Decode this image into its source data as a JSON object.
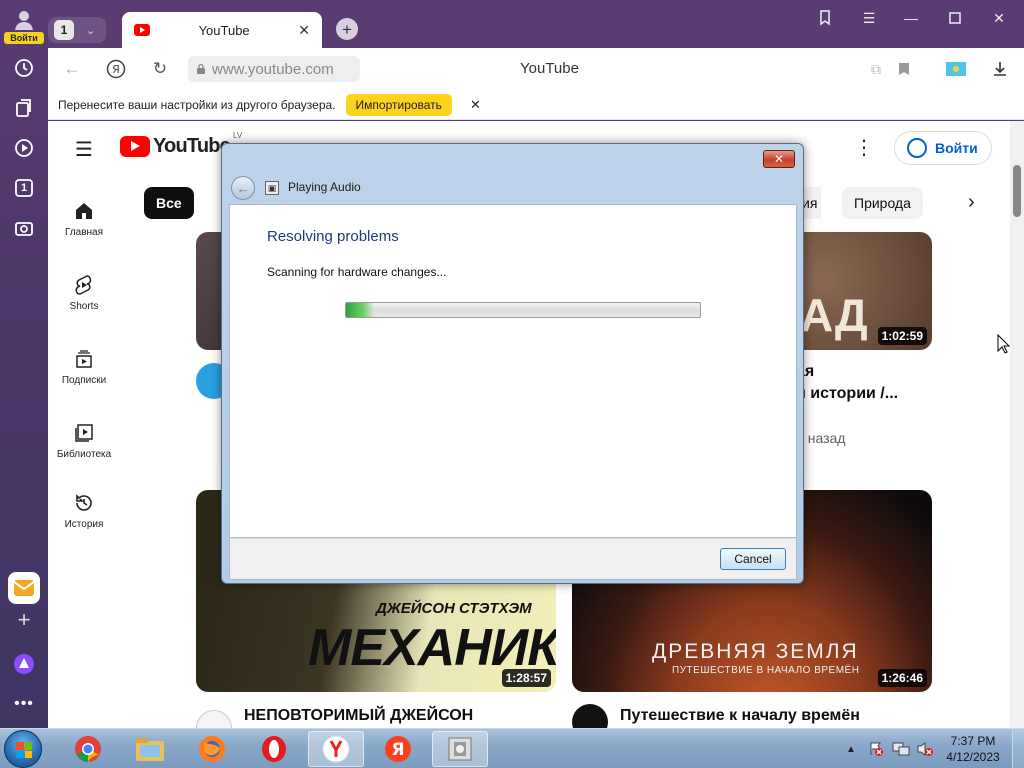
{
  "side_panel": {
    "login_label": "Войти",
    "items": [
      {
        "icon": "history-clock-icon"
      },
      {
        "icon": "collections-icon"
      },
      {
        "icon": "play-circle-icon"
      },
      {
        "icon": "tab-count-icon",
        "label": "1"
      },
      {
        "icon": "screenshot-camera-icon"
      }
    ],
    "bottom": [
      {
        "icon": "mail-icon"
      },
      {
        "icon": "add-icon"
      },
      {
        "icon": "alice-assistant-icon"
      },
      {
        "icon": "more-dots-icon"
      }
    ]
  },
  "tabstrip": {
    "tab_count": "1",
    "active_tab_title": "YouTube",
    "accent": "#5b3c72"
  },
  "addressbar": {
    "url": "www.youtube.com",
    "page_title": "YouTube"
  },
  "infobar": {
    "text": "Перенесите ваши настройки из другого браузера.",
    "import_label": "Импортировать",
    "close_label": "✕"
  },
  "youtube": {
    "logo_text": "YouTube",
    "country_code": "LV",
    "login_label": "Войти",
    "chips": [
      "Все",
      "Природа"
    ],
    "partial_chip": "ия",
    "nav": [
      {
        "label": "Главная",
        "icon": "home-icon"
      },
      {
        "label": "Shorts",
        "icon": "shorts-icon"
      },
      {
        "label": "Подписки",
        "icon": "subscriptions-icon"
      },
      {
        "label": "Библиотека",
        "icon": "library-icon"
      },
      {
        "label": "История",
        "icon": "history-icon"
      }
    ],
    "videos": [
      {
        "duration": "1:02:59",
        "title_line1": "ая",
        "title_line2": "и истории /...",
        "meta": "й назад",
        "thumb_text": "АД"
      },
      {
        "duration": "1:28:57",
        "title": "НЕПОВТОРИМЫЙ ДЖЕЙСОН",
        "thumb_line1": "ДЖЕЙСОН СТЭТХЭМ",
        "thumb_line2": "МЕХАНИК"
      },
      {
        "duration": "1:26:46",
        "title": "Путешествие к началу времён",
        "thumb_line1": "ДРЕВНЯЯ ЗЕМЛЯ",
        "thumb_line2": "ПУТЕШЕСТВИЕ В НАЧАЛО ВРЕМЁН"
      }
    ]
  },
  "dialog": {
    "window_title": "Playing Audio",
    "heading": "Resolving problems",
    "status": "Scanning for hardware changes...",
    "progress": 0.08,
    "cancel_label": "Cancel",
    "close_label": "✕"
  },
  "taskbar": {
    "apps": [
      {
        "icon": "chrome-icon"
      },
      {
        "icon": "file-explorer-icon"
      },
      {
        "icon": "firefox-icon"
      },
      {
        "icon": "opera-icon"
      },
      {
        "icon": "yandex-browser-icon",
        "active": true
      },
      {
        "icon": "yandex-icon"
      },
      {
        "icon": "troubleshooter-icon",
        "active": true
      }
    ],
    "time": "7:37 PM",
    "date": "4/12/2023"
  }
}
